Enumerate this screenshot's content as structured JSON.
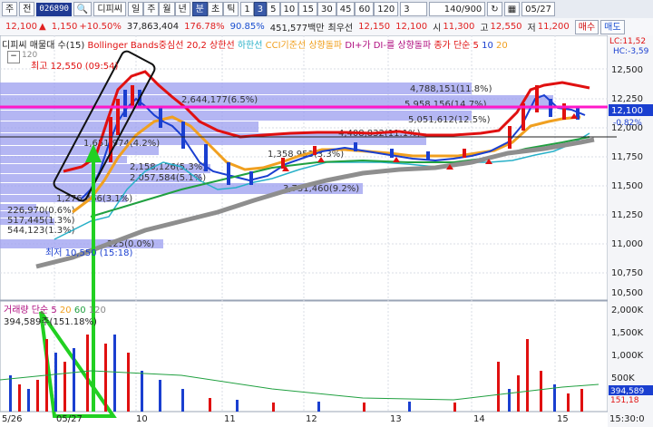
{
  "toolbar": {
    "type_label": "주",
    "market_label": "전",
    "code": "026890",
    "name": "디피씨",
    "period_buttons": [
      "일",
      "주",
      "월",
      "년"
    ],
    "interval_buttons": [
      "분",
      "초",
      "틱",
      "1",
      "3",
      "5",
      "10",
      "15",
      "30",
      "45",
      "60",
      "120"
    ],
    "selected_interval": "3",
    "interval_input": "3",
    "count": "140/900",
    "date": "05/27"
  },
  "quote": {
    "price": "12,100",
    "change": "1,150",
    "rate": "+10.50%",
    "volume": "37,863,404",
    "vol_ratio": "176.78%",
    "strength": "90.85%",
    "amount": "451,577백만",
    "best_ask_label": "최우선",
    "best_ask": "12,150",
    "best_bid": "12,100",
    "open_label": "시",
    "open": "11,300",
    "high_label": "고",
    "high": "12,550",
    "low_label": "저",
    "low": "11,200",
    "buy_label": "매수",
    "sell_label": "매도"
  },
  "legend": {
    "title": "디피씨 매물대 수(15)",
    "bb": "Bollinger Bands중심선 20,2",
    "upper": "상한선",
    "lower": "하한선",
    "cci": "CCI기준선 상향돌파",
    "di": "DI+가 DI-를 상향돌파",
    "ma": "종가 단순 5",
    "ma10": "10",
    "ma20": "20",
    "lc": "LC:11,52",
    "hc": "HC:-3,59",
    "box_120": "120"
  },
  "annotations": {
    "max": "최고 12,550 (09:54)",
    "min": "최저 10,550 (15:18)",
    "last_price": "12,100",
    "last_rate": "-0.82%"
  },
  "volume_legend": {
    "label": "거래량 단순 5",
    "p20": "20",
    "p60": "60",
    "p120": "120",
    "value": "394,589주(151.18%)",
    "last": "394,589",
    "last2": "151,18"
  },
  "chart_data": {
    "type": "candlestick",
    "price_axis": [
      "12,500",
      "12,250",
      "12,000",
      "11,750",
      "11,500",
      "11,250",
      "11,000",
      "10,750",
      "10,500"
    ],
    "ylim": [
      10500,
      12550
    ],
    "volume_axis": [
      "2,000K",
      "1,500K",
      "1,000K",
      "500K"
    ],
    "x_ticks": [
      "5/26",
      "05/27",
      "10",
      "11",
      "12",
      "13",
      "14",
      "15",
      "15:30:0"
    ],
    "volume_profile": [
      {
        "price": 12250,
        "label": "4,788,151(11.8%)"
      },
      {
        "price": 12150,
        "label": "5,958,156(14.7%)"
      },
      {
        "price": 12100,
        "label": "5,051,612(12.5%)"
      },
      {
        "price": 12000,
        "label": "2,644,177(6.5%)"
      },
      {
        "price": 11950,
        "label": "4,408,832(11.1%)"
      },
      {
        "price": 11850,
        "label": "1,651,974(4.2%)"
      },
      {
        "price": 11750,
        "label": "1,358,953(3.3%)"
      },
      {
        "price": 11650,
        "label": "2,158,126(5.3%)"
      },
      {
        "price": 11550,
        "label": "2,057,584(5.1%)"
      },
      {
        "price": 11450,
        "label": "3,731,460(9.2%)"
      },
      {
        "price": 11350,
        "label": "1,276,466(3.1%)"
      },
      {
        "price": 11200,
        "label": "226,970(0.6%)"
      },
      {
        "price": 11100,
        "label": "517,445(1.3%)"
      },
      {
        "price": 11000,
        "label": "544,123(1.3%)"
      },
      {
        "price": 10850,
        "label": "225(0.0%)"
      }
    ]
  }
}
